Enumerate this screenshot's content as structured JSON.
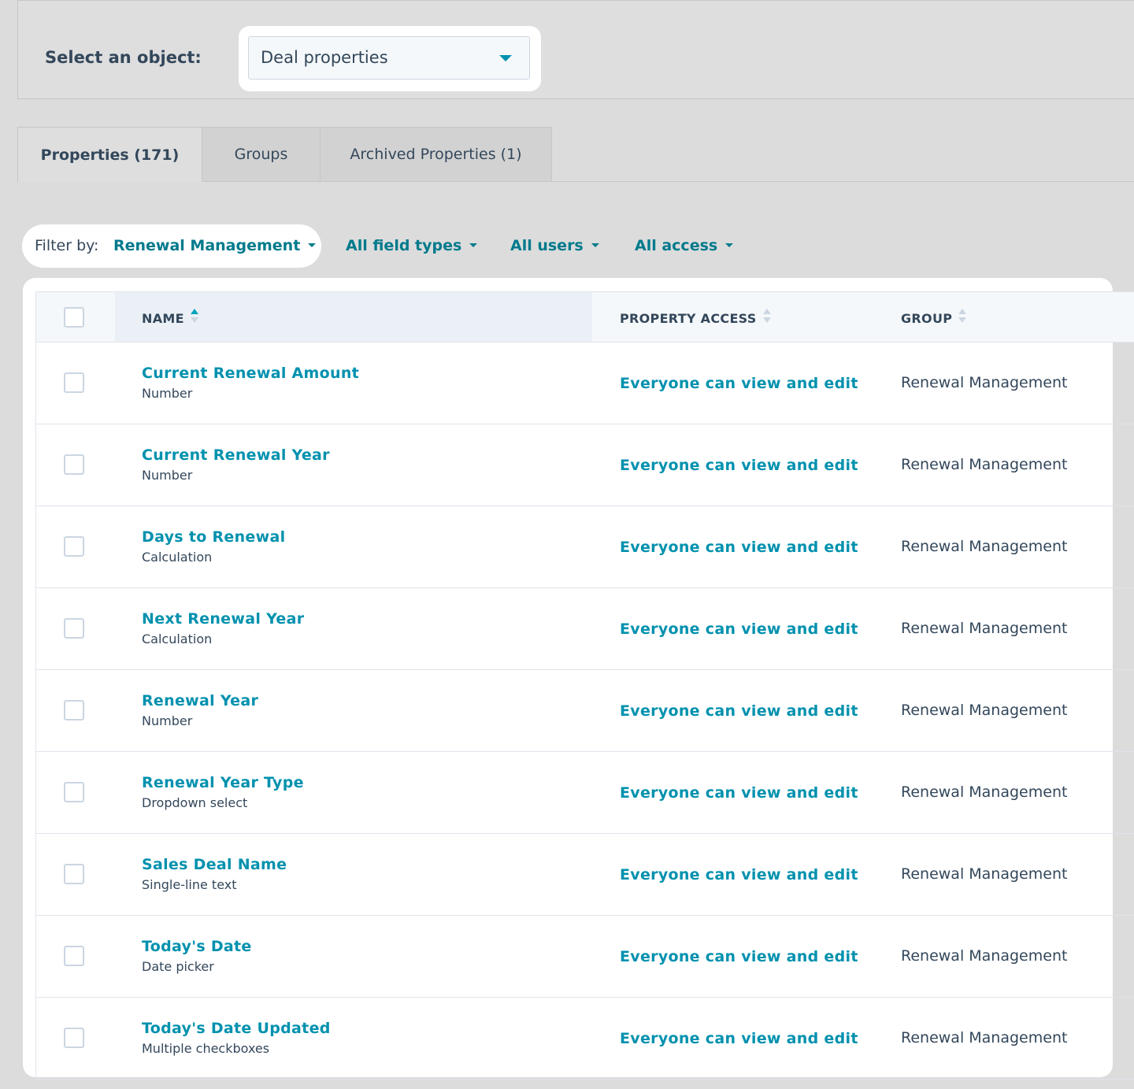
{
  "object_select": {
    "label": "Select an object:",
    "value": "Deal properties"
  },
  "tabs": [
    {
      "label": "Properties (171)",
      "active": true
    },
    {
      "label": "Groups",
      "active": false
    },
    {
      "label": "Archived Properties (1)",
      "active": false
    }
  ],
  "filters": {
    "label": "Filter by:",
    "group": "Renewal Management",
    "field_types": "All field types",
    "users": "All users",
    "access": "All access"
  },
  "table": {
    "headers": {
      "name": "NAME",
      "access": "PROPERTY ACCESS",
      "group": "GROUP"
    },
    "rows": [
      {
        "name": "Current Renewal Amount",
        "type": "Number",
        "access": "Everyone can view and edit",
        "group": "Renewal Management"
      },
      {
        "name": "Current Renewal Year",
        "type": "Number",
        "access": "Everyone can view and edit",
        "group": "Renewal Management"
      },
      {
        "name": "Days to Renewal",
        "type": "Calculation",
        "access": "Everyone can view and edit",
        "group": "Renewal Management"
      },
      {
        "name": "Next Renewal Year",
        "type": "Calculation",
        "access": "Everyone can view and edit",
        "group": "Renewal Management"
      },
      {
        "name": "Renewal Year",
        "type": "Number",
        "access": "Everyone can view and edit",
        "group": "Renewal Management"
      },
      {
        "name": "Renewal Year Type",
        "type": "Dropdown select",
        "access": "Everyone can view and edit",
        "group": "Renewal Management"
      },
      {
        "name": "Sales Deal Name",
        "type": "Single-line text",
        "access": "Everyone can view and edit",
        "group": "Renewal Management"
      },
      {
        "name": "Today's Date",
        "type": "Date picker",
        "access": "Everyone can view and edit",
        "group": "Renewal Management"
      },
      {
        "name": "Today's Date Updated",
        "type": "Multiple checkboxes",
        "access": "Everyone can view and edit",
        "group": "Renewal Management"
      }
    ]
  }
}
